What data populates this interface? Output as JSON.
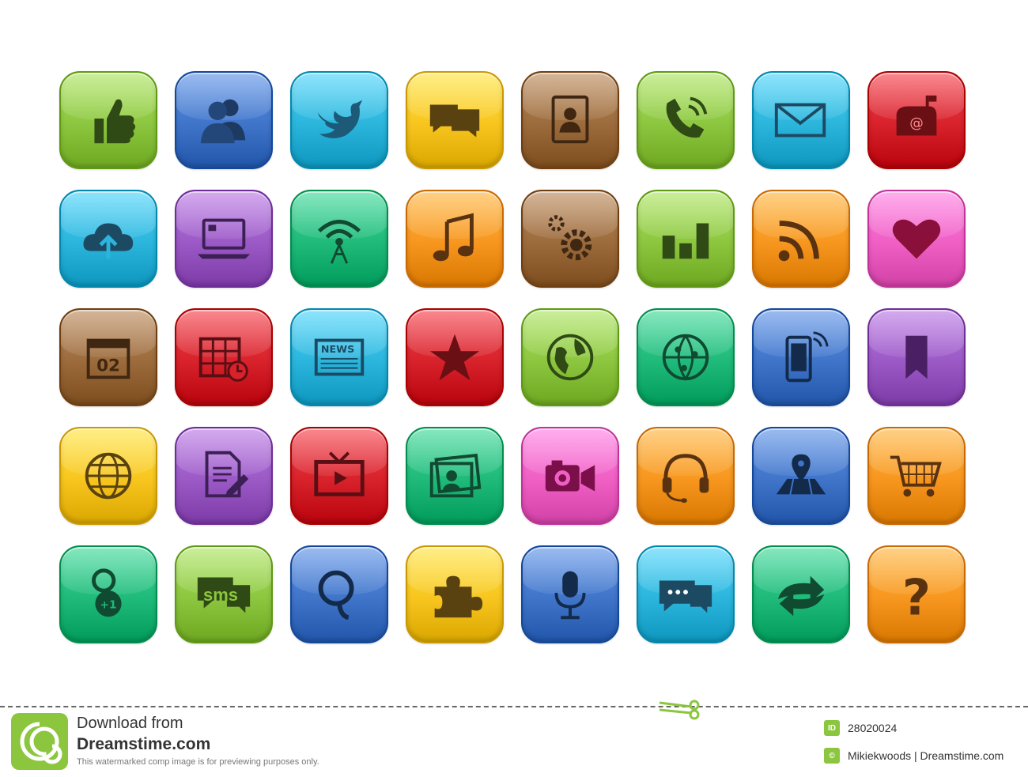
{
  "icons": [
    {
      "name": "thumbs-up-icon",
      "color": "#8cc63f"
    },
    {
      "name": "users-icon",
      "color": "#3f74c9"
    },
    {
      "name": "twitter-bird-icon",
      "color": "#2bb5dc"
    },
    {
      "name": "chat-bubbles-icon",
      "color": "#f7c51e"
    },
    {
      "name": "address-book-icon",
      "color": "#9c6b3c"
    },
    {
      "name": "phone-icon",
      "color": "#8cc63f"
    },
    {
      "name": "mail-icon",
      "color": "#2bb5dc"
    },
    {
      "name": "mailbox-icon",
      "color": "#d7212b"
    },
    {
      "name": "cloud-upload-icon",
      "color": "#2bb5dc"
    },
    {
      "name": "laptop-icon",
      "color": "#9b59c6"
    },
    {
      "name": "antenna-icon",
      "color": "#1fba7a"
    },
    {
      "name": "music-note-icon",
      "color": "#f7961e"
    },
    {
      "name": "settings-gears-icon",
      "color": "#9c6b3c"
    },
    {
      "name": "bar-chart-icon",
      "color": "#8cc63f"
    },
    {
      "name": "rss-icon",
      "color": "#f7961e"
    },
    {
      "name": "heart-icon",
      "color": "#ef5fc4"
    },
    {
      "name": "calendar-date-icon",
      "color": "#9c6b3c"
    },
    {
      "name": "calendar-clock-icon",
      "color": "#d7212b"
    },
    {
      "name": "newspaper-icon",
      "color": "#2bb5dc"
    },
    {
      "name": "star-icon",
      "color": "#d7212b"
    },
    {
      "name": "earth-icon",
      "color": "#8cc63f"
    },
    {
      "name": "network-globe-icon",
      "color": "#1fba7a"
    },
    {
      "name": "mobile-phone-icon",
      "color": "#3f74c9"
    },
    {
      "name": "bookmark-icon",
      "color": "#9b59c6"
    },
    {
      "name": "globe-grid-icon",
      "color": "#f7c51e"
    },
    {
      "name": "document-edit-icon",
      "color": "#9b59c6"
    },
    {
      "name": "tv-play-icon",
      "color": "#d7212b"
    },
    {
      "name": "photo-contact-icon",
      "color": "#1fba7a"
    },
    {
      "name": "camera-icon",
      "color": "#ef5fc4"
    },
    {
      "name": "headset-icon",
      "color": "#f7961e"
    },
    {
      "name": "map-pin-icon",
      "color": "#3f74c9"
    },
    {
      "name": "shopping-cart-icon",
      "color": "#f7961e"
    },
    {
      "name": "google-plus-icon",
      "color": "#1fba7a"
    },
    {
      "name": "sms-icon",
      "color": "#8cc63f",
      "label": "sms"
    },
    {
      "name": "search-icon",
      "color": "#3f74c9"
    },
    {
      "name": "puzzle-icon",
      "color": "#f7c51e"
    },
    {
      "name": "microphone-icon",
      "color": "#3f74c9"
    },
    {
      "name": "chat-dots-icon",
      "color": "#2bb5dc"
    },
    {
      "name": "share-arrows-icon",
      "color": "#1fba7a"
    },
    {
      "name": "question-icon",
      "color": "#f7961e"
    }
  ],
  "footer": {
    "download_from": "Download from",
    "site": "Dreamstime.com",
    "note": "This watermarked comp image is for previewing purposes only.",
    "id_badge": "ID",
    "image_id": "28020024",
    "credit": "Mikiekwoods | Dreamstime.com"
  }
}
